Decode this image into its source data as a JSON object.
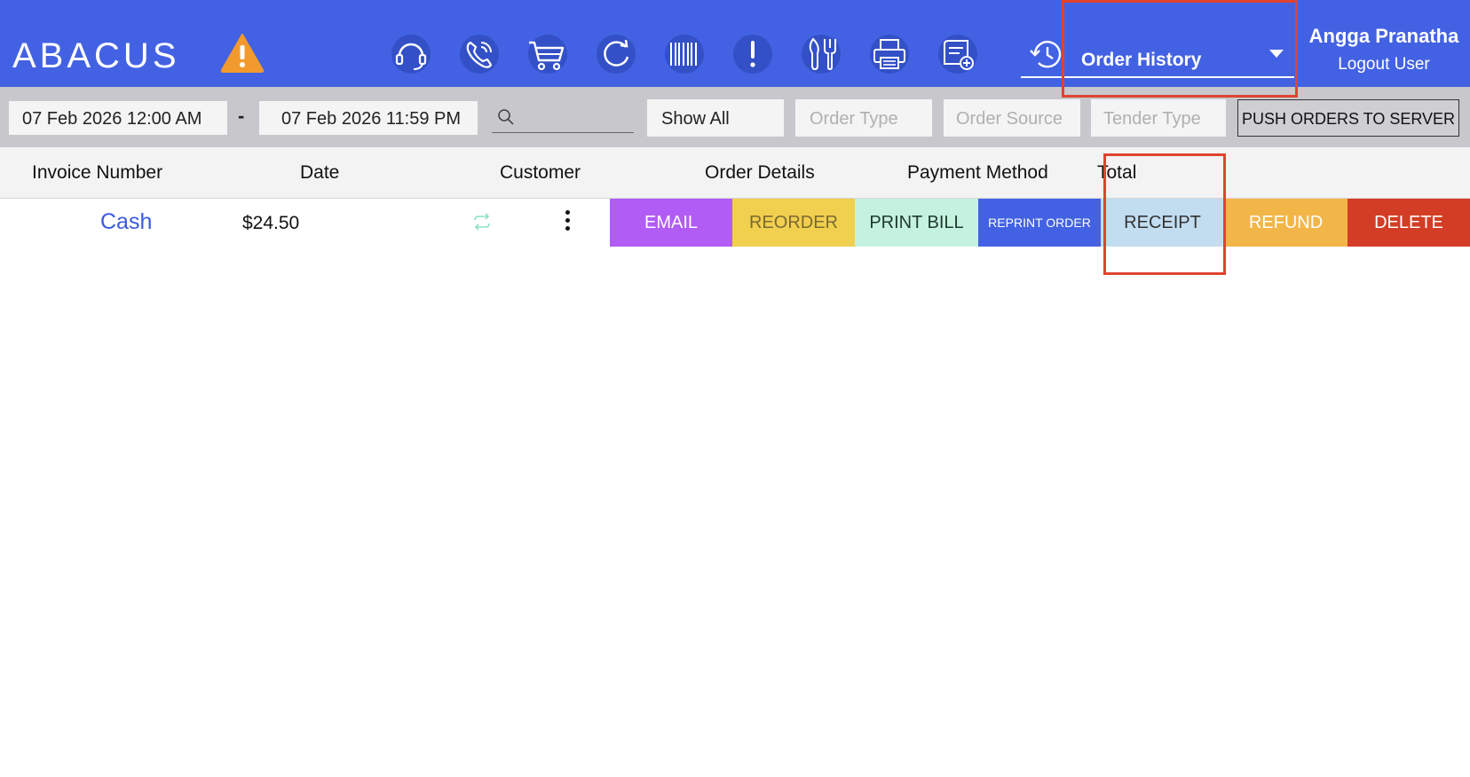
{
  "header": {
    "logo": "ABACUS",
    "nav_select": "Order History",
    "user_name": "Angga Pranatha",
    "logout": "Logout User",
    "icons": [
      "warning-icon",
      "headset-icon",
      "phone-icon",
      "cart-icon",
      "refresh-icon",
      "barcode-icon",
      "alert-icon",
      "utensils-icon",
      "printer-icon",
      "receipt-add-icon",
      "history-icon"
    ]
  },
  "filters": {
    "date_from": "07 Feb 2026 12:00 AM",
    "separator": "-",
    "date_to": "07 Feb 2026 11:59 PM",
    "search_value": "",
    "show": "Show All",
    "order_type_placeholder": "Order Type",
    "order_source_placeholder": "Order Source",
    "tender_type_placeholder": "Tender Type",
    "push_button": "PUSH ORDERS TO SERVER"
  },
  "table": {
    "columns": [
      "Invoice Number",
      "Date",
      "Customer",
      "Order Details",
      "Payment Method",
      "Total"
    ],
    "rows": [
      {
        "payment": "Cash",
        "total": "$24.50",
        "actions": [
          "EMAIL",
          "REORDER",
          "PRINT BILL",
          "REPRINT ORDER",
          "RECEIPT",
          "REFUND",
          "DELETE"
        ]
      }
    ]
  },
  "colors": {
    "header_bg": "#4362e3",
    "filter_bg": "#c8c8cc",
    "email": "#b15cf5",
    "reorder": "#f1cf4f",
    "print_bill": "#c4f2de",
    "reprint_order": "#4362e3",
    "receipt": "#c3ddf0",
    "refund": "#f2b648",
    "delete": "#d43d25",
    "highlight": "#e0432f"
  }
}
